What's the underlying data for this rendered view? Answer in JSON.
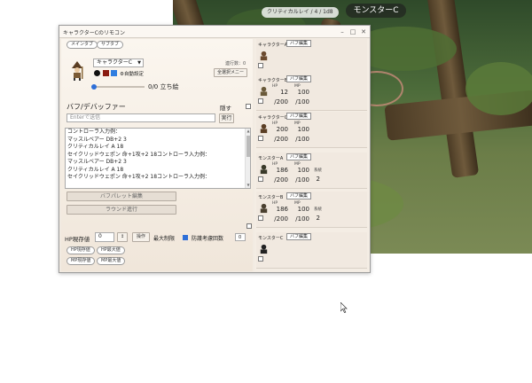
{
  "scene": {
    "skill_label": "クリティカルレイ / 4 / 1d8",
    "monster_label": "モンスターC"
  },
  "window": {
    "title": "キャラクターCのリモコン"
  },
  "tabs": [
    {
      "label": "メインタブ"
    },
    {
      "label": "サブタブ"
    }
  ],
  "character": {
    "selected": "キャラクターC",
    "auto_setting_label": "自動設定",
    "turn_label": "0/0 立ち絵",
    "turn_count_label": "連行数：0",
    "selection_label": "全選択メニー"
  },
  "buff": {
    "heading": "バフ/デバッファー",
    "hide_label": "隠す",
    "input_placeholder": "Enterで送信",
    "exec_label": "実行"
  },
  "log_lines": [
    "コントローラ入力例：",
    "マッスルベアー DB+2 3",
    "クリティカルレイ A 18",
    "セイクリッドウェポン 命+1攻+2 18コントローラ入力例：",
    "マッスルベアー DB+2 3",
    "クリティカルレイ A 18",
    "セイクリッドウェポン 命+1攻+2 18コントローラ入力例："
  ],
  "actions": {
    "palette_label": "バフパレット編集",
    "round_label": "ラウンド進行"
  },
  "hp": {
    "label": "HP現存値",
    "value": "0",
    "op_label": "操作",
    "max_limit_label": "最大制限",
    "defense_label": "防護考慮回数",
    "defense_value": "0",
    "buttons": [
      "HP現存値",
      "HP最大値",
      "MP現存値",
      "MP最大値"
    ]
  },
  "cards": [
    {
      "name": "キャラクターA",
      "buff": "バフ編集",
      "has_stats": false
    },
    {
      "name": "キャラクターB",
      "buff": "バフ編集",
      "has_stats": true,
      "hp_label": "HP",
      "mp_label": "MP",
      "hp": "12",
      "hp_max": "/200",
      "mp": "100",
      "mp_max": "/100"
    },
    {
      "name": "キャラクターC",
      "buff": "バフ編集",
      "has_stats": true,
      "hp_label": "HP",
      "mp_label": "MP",
      "hp": "200",
      "hp_max": "/200",
      "mp": "100",
      "mp_max": "/100"
    },
    {
      "name": "モンスターA",
      "buff": "バフ編集",
      "has_stats": true,
      "hp_label": "HP",
      "mp_label": "MP",
      "hp": "186",
      "hp_max": "/200",
      "mp": "100",
      "mp_max": "/100",
      "extra_label": "系統",
      "extra": "2"
    },
    {
      "name": "モンスターB",
      "buff": "バフ編集",
      "has_stats": true,
      "hp_label": "HP",
      "mp_label": "MP",
      "hp": "186",
      "hp_max": "/200",
      "mp": "100",
      "mp_max": "/100",
      "extra_label": "系統",
      "extra": "2"
    },
    {
      "name": "モンスターC",
      "buff": "バフ編集",
      "has_stats": false
    }
  ],
  "colors": {
    "accent": "#2e6fd8",
    "swatch_black": "#111111",
    "swatch_red": "#8a1c12",
    "swatch_blue": "#2f7de0"
  }
}
